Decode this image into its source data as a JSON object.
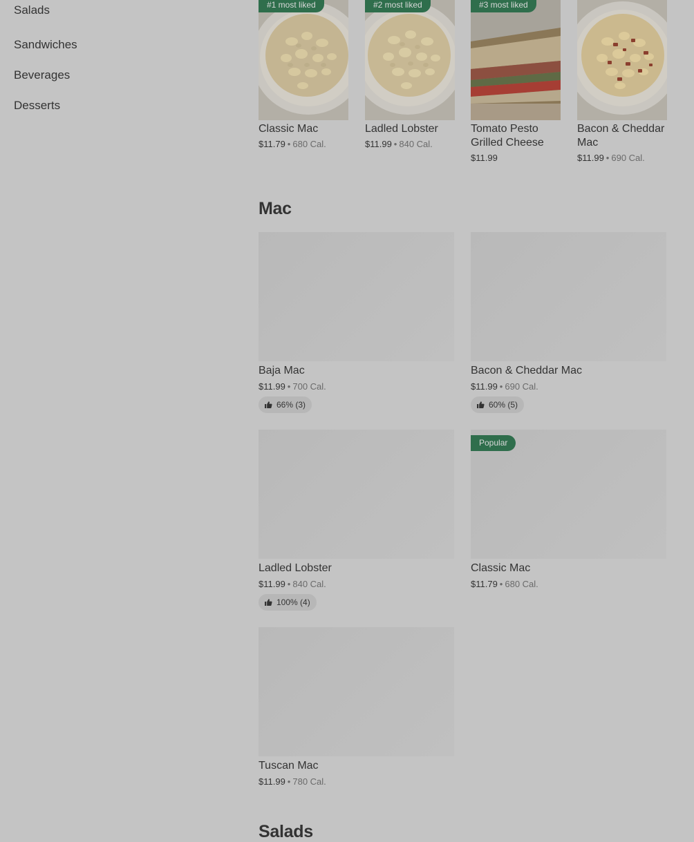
{
  "sidebar": {
    "items": [
      {
        "label": "Salads"
      },
      {
        "label": "Sandwiches"
      },
      {
        "label": "Beverages"
      },
      {
        "label": "Desserts"
      }
    ]
  },
  "featured": {
    "items": [
      {
        "badge": "#1 most liked",
        "name": "Classic Mac",
        "price": "$11.79",
        "separator": "•",
        "calories": "680 Cal.",
        "image": "mac-bowl-image"
      },
      {
        "badge": "#2 most liked",
        "name": "Ladled Lobster",
        "price": "$11.99",
        "separator": "•",
        "calories": "840 Cal.",
        "image": "mac-bowl-image"
      },
      {
        "badge": "#3 most liked",
        "name": "Tomato Pesto Grilled Cheese",
        "price": "$11.99",
        "image": "grilled-cheese-image"
      },
      {
        "name": "Bacon & Cheddar Mac",
        "price": "$11.99",
        "separator": "•",
        "calories": "690 Cal.",
        "image": "bacon-mac-bowl-image"
      }
    ]
  },
  "sections": {
    "mac": {
      "title": "Mac",
      "items": [
        {
          "name": "Baja Mac",
          "price": "$11.99",
          "separator": "•",
          "calories": "700 Cal.",
          "rating": "66% (3)",
          "rating_icon": "thumbs-up-icon"
        },
        {
          "name": "Bacon & Cheddar Mac",
          "price": "$11.99",
          "separator": "•",
          "calories": "690 Cal.",
          "rating": "60% (5)",
          "rating_icon": "thumbs-up-icon"
        },
        {
          "name": "Ladled Lobster",
          "price": "$11.99",
          "separator": "•",
          "calories": "840 Cal.",
          "rating": "100% (4)",
          "rating_icon": "thumbs-up-icon"
        },
        {
          "name": "Classic Mac",
          "price": "$11.79",
          "separator": "•",
          "calories": "680 Cal.",
          "badge": "Popular"
        },
        {
          "name": "Tuscan Mac",
          "price": "$11.99",
          "separator": "•",
          "calories": "780 Cal."
        }
      ]
    },
    "salads": {
      "title": "Salads"
    }
  },
  "colors": {
    "background": "#c4c4c4",
    "text": "#333333",
    "muted_text": "#6a6a6a",
    "badge_green": "#2f6e4c",
    "rating_pill": "#b7b7b7",
    "image_placeholder": "#bcbcbc"
  }
}
